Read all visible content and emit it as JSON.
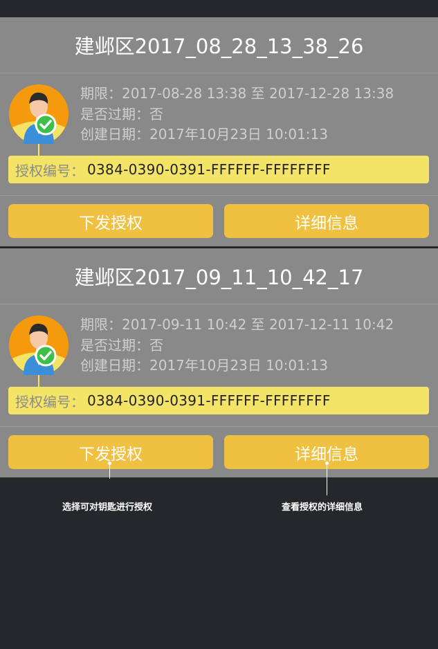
{
  "cards": [
    {
      "title": "建邺区2017_08_28_13_38_26",
      "period_label": "期限：",
      "period_value": "2017-08-28 13:38 至 2017-12-28 13:38",
      "expired_label": "是否过期：",
      "expired_value": "否",
      "created_label": "创建日期：",
      "created_value": "2017年10月23日 10:01:13",
      "auth_label": "授权编号：",
      "auth_value": "0384-0390-0391-FFFFFF-FFFFFFFF",
      "issue_button": "下发授权",
      "detail_button": "详细信息"
    },
    {
      "title": "建邺区2017_09_11_10_42_17",
      "period_label": "期限：",
      "period_value": "2017-09-11 10:42 至 2017-12-11 10:42",
      "expired_label": "是否过期：",
      "expired_value": "否",
      "created_label": "创建日期：",
      "created_value": "2017年10月23日 10:01:13",
      "auth_label": "授权编号：",
      "auth_value": "0384-0390-0391-FFFFFF-FFFFFFFF",
      "issue_button": "下发授权",
      "detail_button": "详细信息"
    }
  ],
  "annotations": {
    "issue_hint": "选择可对钥匙进行授权",
    "detail_hint": "查看授权的详细信息"
  },
  "icons": {
    "avatar": "user-avatar-icon",
    "check": "check-badge-icon"
  },
  "colors": {
    "background": "#26272b",
    "card": "#898989",
    "auth_highlight": "#f3e467",
    "button": "#f0c040",
    "check": "#3cc04a",
    "avatar_bg": "#f59a0c"
  }
}
